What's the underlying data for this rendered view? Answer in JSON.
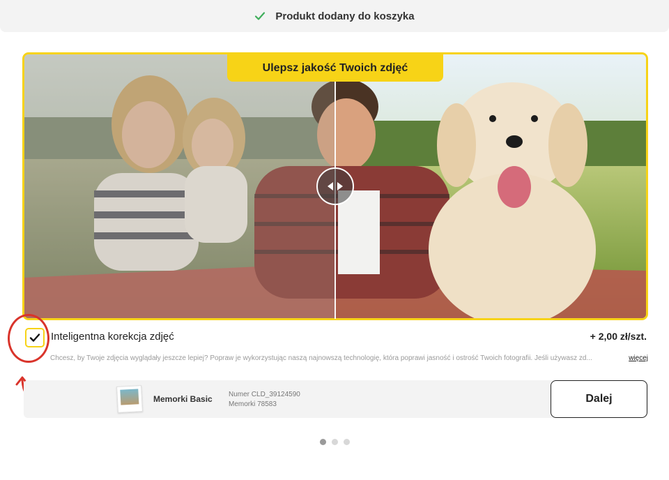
{
  "topbar": {
    "icon": "check-icon",
    "message": "Produkt dodany do koszyka",
    "icon_color": "#3fae5b"
  },
  "upsell": {
    "banner_title": "Ulepsz jakość Twoich zdjęć",
    "accent_color": "#f7d317",
    "slider_icon": "left-right-arrows-icon",
    "option": {
      "checked": true,
      "label": "Inteligentna korekcja zdjęć",
      "price": "+ 2,00 zł/szt.",
      "description": "Chcesz, by Twoje zdjęcia wyglądały jeszcze lepiej? Popraw je wykorzystując naszą najnowszą technologię, która poprawi jasność i ostrość Twoich fotografii. Jeśli używasz zd...",
      "more_link": "więcej"
    }
  },
  "product": {
    "name": "Memorki Basic",
    "meta_line1": "Numer CLD_39124590",
    "meta_line2": "Memorki 78583",
    "next_label": "Dalej"
  },
  "pagination": {
    "total": 3,
    "active": 0
  },
  "annotation": {
    "color": "#d9342b"
  }
}
